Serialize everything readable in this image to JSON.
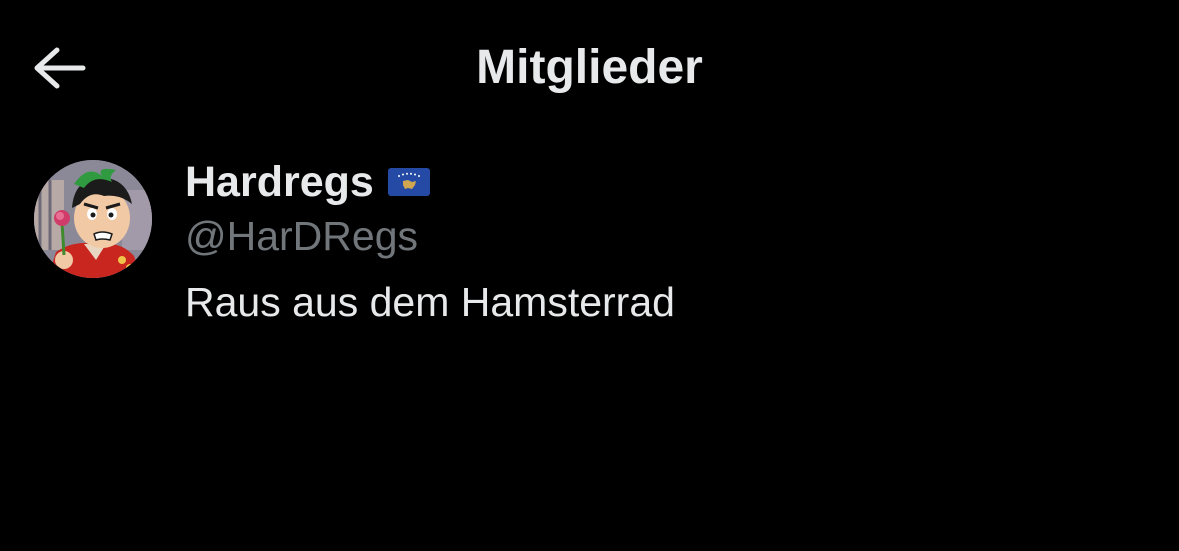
{
  "header": {
    "title": "Mitglieder",
    "back_icon": "arrow-left-icon"
  },
  "members": [
    {
      "display_name": "Hardregs",
      "handle": "@HarDRegs",
      "bio": "Raus aus dem Hamsterrad",
      "badge_icon": "kosovo-flag-icon"
    }
  ],
  "colors": {
    "background": "#000000",
    "primary_text": "#e7e9ea",
    "secondary_text": "#71767b"
  }
}
